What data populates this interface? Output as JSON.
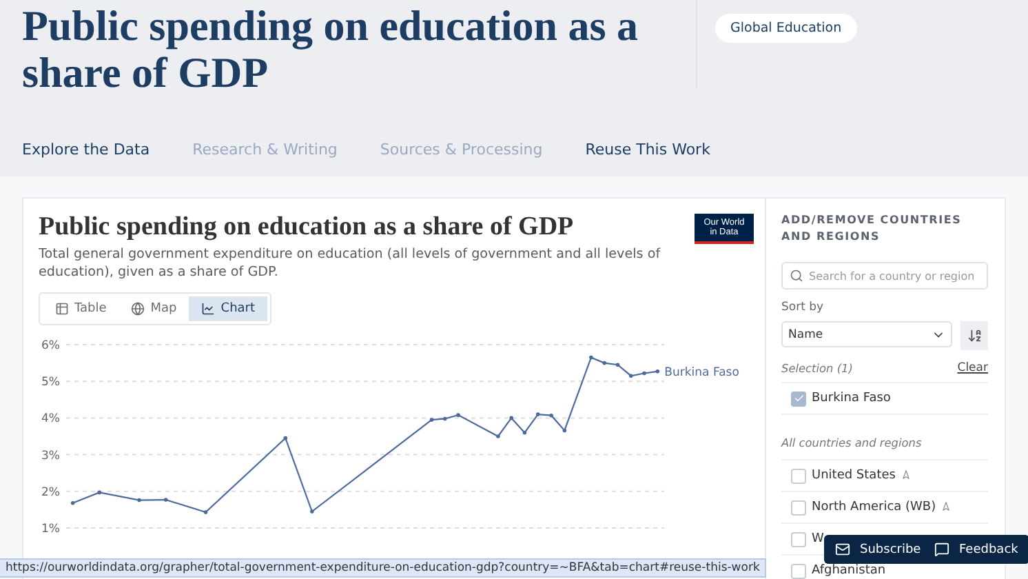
{
  "header": {
    "title": "Public spending on education as a share of GDP",
    "tag": "Global Education"
  },
  "tabs": [
    {
      "label": "Explore the Data",
      "dimmed": false
    },
    {
      "label": "Research & Writing",
      "dimmed": true
    },
    {
      "label": "Sources & Processing",
      "dimmed": true
    },
    {
      "label": "Reuse This Work",
      "dimmed": false
    }
  ],
  "chart_card": {
    "title": "Public spending on education as a share of GDP",
    "subtitle": "Total general government expenditure on education (all levels of government and all levels of education), given as a share of GDP.",
    "logo": [
      "Our World",
      "in Data"
    ],
    "views": [
      {
        "label": "Table",
        "kind": "table",
        "selected": false
      },
      {
        "label": "Map",
        "kind": "map",
        "selected": false
      },
      {
        "label": "Chart",
        "kind": "chart",
        "selected": true
      }
    ],
    "chart_data": {
      "type": "line",
      "grid": true,
      "ylim": [
        1,
        6
      ],
      "yticks": [
        {
          "value": 1,
          "label": "1%"
        },
        {
          "value": 2,
          "label": "2%"
        },
        {
          "value": 3,
          "label": "3%"
        },
        {
          "value": 4,
          "label": "4%"
        },
        {
          "value": 5,
          "label": "5%"
        },
        {
          "value": 6,
          "label": "6%"
        }
      ],
      "series": [
        {
          "name": "Burkina Faso",
          "color": "#4c6a9c",
          "values": [
            1.68,
            null,
            1.97,
            null,
            null,
            1.76,
            null,
            1.77,
            null,
            null,
            1.43,
            null,
            null,
            null,
            null,
            null,
            3.45,
            null,
            1.45,
            null,
            null,
            null,
            null,
            null,
            null,
            null,
            null,
            3.95,
            3.98,
            4.08,
            null,
            null,
            3.5,
            4.0,
            3.6,
            4.1,
            4.07,
            3.66,
            null,
            5.65,
            5.5,
            5.45,
            5.15,
            5.22,
            5.27
          ]
        }
      ]
    }
  },
  "sidebar": {
    "heading": "ADD/REMOVE COUNTRIES AND REGIONS",
    "search_placeholder": "Search for a country or region",
    "sort_label": "Sort by",
    "sort_value": "Name",
    "selection_label": "Selection (1)",
    "clear": "Clear",
    "selected": [
      {
        "name": "Burkina Faso",
        "checked": true
      }
    ],
    "all_label": "All countries and regions",
    "countries": [
      {
        "name": "United States",
        "checked": false,
        "nearby": true
      },
      {
        "name": "North America (WB)",
        "checked": false,
        "nearby": true
      },
      {
        "name": "W",
        "checked": false,
        "nearby": false
      },
      {
        "name": "Afghanistan",
        "checked": false,
        "nearby": false
      }
    ]
  },
  "floating_buttons": [
    {
      "label": "Subscribe",
      "kind": "subscribe"
    },
    {
      "label": "Feedback",
      "kind": "feedback"
    }
  ],
  "status_bar": "https://ourworldindata.org/grapher/total-government-expenditure-on-education-gdp?country=~BFA&tab=chart#reuse-this-work"
}
